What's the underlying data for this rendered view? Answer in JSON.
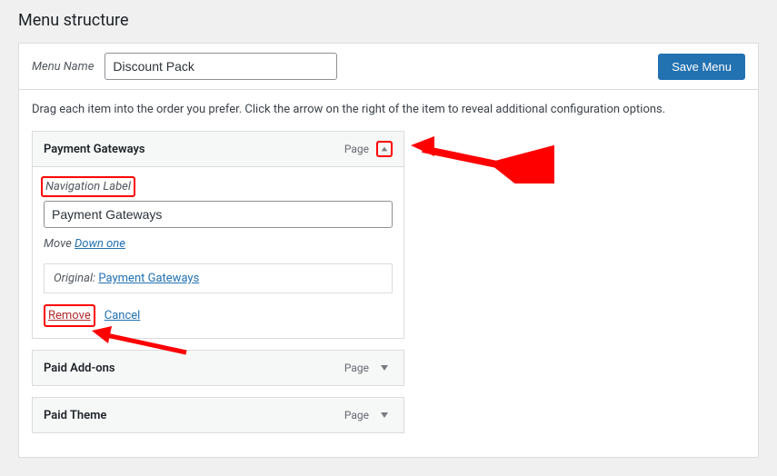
{
  "section_title": "Menu structure",
  "header": {
    "menu_name_label": "Menu Name",
    "menu_name_value": "Discount Pack",
    "save_label": "Save Menu"
  },
  "instructions": "Drag each item into the order you prefer. Click the arrow on the right of the item to reveal additional configuration options.",
  "items": [
    {
      "title": "Payment Gateways",
      "type_label": "Page",
      "expanded": true,
      "settings": {
        "nav_label_text": "Navigation Label",
        "nav_label_value": "Payment Gateways",
        "move_label": "Move",
        "move_down_label": "Down one",
        "original_label": "Original:",
        "original_link_text": "Payment Gateways",
        "remove_label": "Remove",
        "cancel_label": "Cancel"
      }
    },
    {
      "title": "Paid Add-ons",
      "type_label": "Page",
      "expanded": false
    },
    {
      "title": "Paid Theme",
      "type_label": "Page",
      "expanded": false
    }
  ]
}
